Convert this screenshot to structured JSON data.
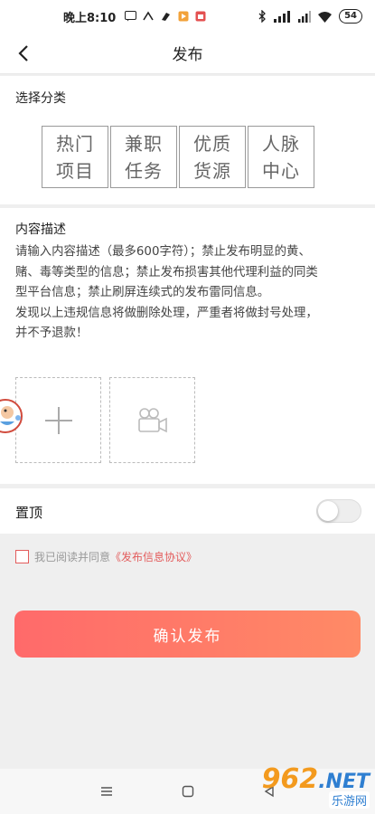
{
  "status_bar": {
    "time": "晚上8:10",
    "battery": "54",
    "icons": [
      "message-icon",
      "app-icon",
      "notification-icon",
      "play-icon",
      "store-icon"
    ]
  },
  "header": {
    "title": "发布"
  },
  "category": {
    "label": "选择分类",
    "items": [
      {
        "line1": "热门",
        "line2": "项目"
      },
      {
        "line1": "兼职",
        "line2": "任务"
      },
      {
        "line1": "优质",
        "line2": "货源"
      },
      {
        "line1": "人脉",
        "line2": "中心"
      }
    ]
  },
  "content": {
    "label": "内容描述",
    "placeholder_line1": "请输入内容描述（最多600字符）；禁止发布明显的黄、",
    "placeholder_line2": "赌、毒等类型的信息；禁止发布损害其他代理利益的同类",
    "placeholder_line3": "型平台信息；禁止刷屏连续式的发布雷同信息。",
    "placeholder_line4": "发现以上违规信息将做删除处理，严重者将做封号处理，",
    "placeholder_line5": "并不予退款！"
  },
  "pin": {
    "label": "置顶",
    "enabled": false
  },
  "agreement": {
    "text": "我已阅读并同意",
    "link": "《发布信息协议》"
  },
  "submit": {
    "label": "确认发布"
  },
  "watermark": {
    "main": "962",
    "suffix": ".NET",
    "sub": "乐游网"
  },
  "colors": {
    "accent": "#e35c5c",
    "button_start": "#ff6a6a",
    "button_end": "#ff8a66",
    "background": "#efefef"
  }
}
